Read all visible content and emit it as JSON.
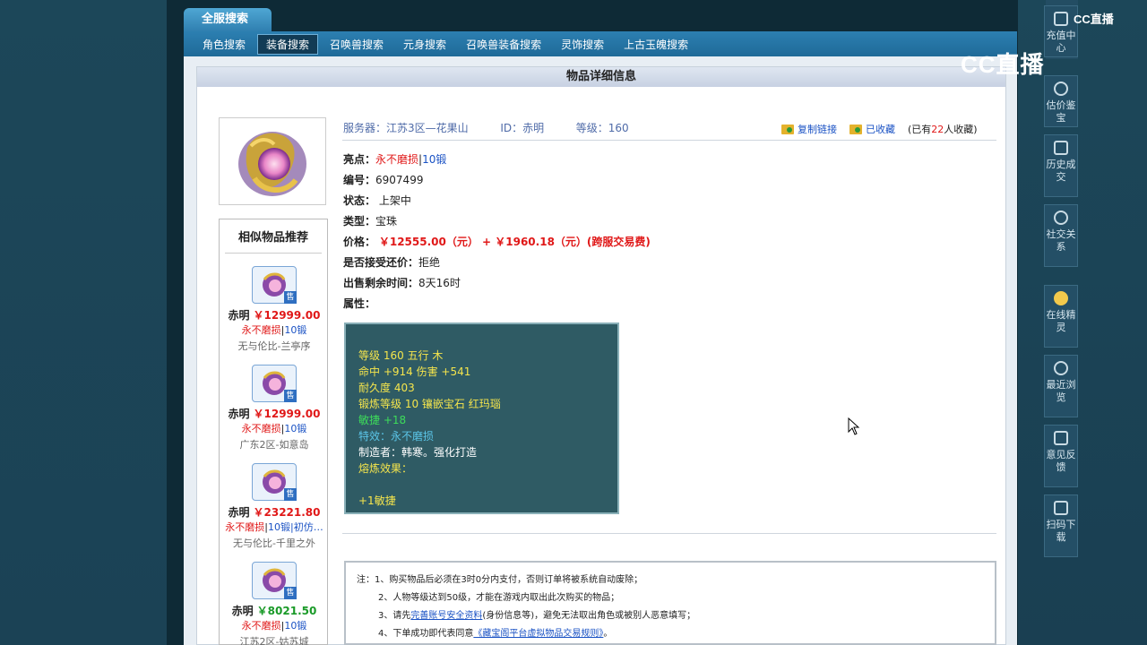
{
  "nav": {
    "top_tab": "全服搜索",
    "sub_tabs": [
      "角色搜索",
      "装备搜索",
      "召唤兽搜索",
      "元身搜索",
      "召唤兽装备搜索",
      "灵饰搜索",
      "上古玉魄搜索"
    ],
    "active_sub_tab": "装备搜索"
  },
  "detail": {
    "header": "物品详细信息",
    "server_label": "服务器：",
    "server_value": "江苏3区—花果山",
    "id_label": "ID：",
    "id_value": "赤明",
    "level_label": "等级：",
    "level_value": "160",
    "copy_link": "复制链接",
    "collected": "已收藏",
    "collect_prefix": "(已有",
    "collect_count": "22",
    "collect_suffix": "人收藏)",
    "highlight_label": "亮点：",
    "highlight_red": "永不磨损",
    "highlight_sep": "|",
    "highlight_blue": "10锻",
    "serial_label": "编号：",
    "serial_value": "6907499",
    "status_label": "状态：",
    "status_value": "上架中",
    "type_label": "类型：",
    "type_value": "宝珠",
    "price_label": "价格：",
    "price_value": "￥12555.00（元） + ￥1960.18（元）(跨服交易费)",
    "bargain_label": "是否接受还价：",
    "bargain_value": "拒绝",
    "remaining_label": "出售剩余时间：",
    "remaining_value": "8天16时",
    "attr_label": "属性："
  },
  "attributes": {
    "line1": "等级 160  五行 木",
    "line2": "命中 +914 伤害 +541",
    "line3": "耐久度 403",
    "line4": "锻炼等级 10  镶嵌宝石 红玛瑙",
    "line5": "敏捷 +18",
    "line6": "特效：永不磨损",
    "line7": "制造者：韩寒。强化打造",
    "line8": "熔炼效果：",
    "line9": "+1敏捷"
  },
  "similar": {
    "title": "相似物品推荐",
    "sell_badge": "售",
    "items": [
      {
        "name": "赤明",
        "price": "￥12999.00",
        "tag_red": "永不磨损",
        "sep": "|",
        "tag_blue": "10锻",
        "extra": "",
        "server": "无与伦比-兰亭序"
      },
      {
        "name": "赤明",
        "price": "￥12999.00",
        "tag_red": "永不磨损",
        "sep": "|",
        "tag_blue": "10锻",
        "extra": "",
        "server": "广东2区-如意岛"
      },
      {
        "name": "赤明",
        "price": "￥23221.80",
        "tag_red": "永不磨损",
        "sep": "|",
        "tag_blue": "10锻",
        "extra": "|初仿…",
        "server": "无与伦比-千里之外"
      },
      {
        "name": "赤明",
        "price": "￥8021.50",
        "tag_red": "永不磨损",
        "sep": "|",
        "tag_blue": "10锻",
        "extra": "",
        "server": "江苏2区-姑苏城"
      }
    ]
  },
  "notes": {
    "prefix": "注：",
    "n1": "1、购买物品后必须在3时0分内支付，否则订单将被系统自动废除；",
    "n2": "2、人物等级达到50级，才能在游戏内取出此次购买的物品；",
    "n3_a": "3、请先",
    "n3_link": "完善账号安全资料",
    "n3_b": "(身份信息等)，避免无法取出角色或被别人恶意填写；",
    "n4_a": "4、下单成功即代表同意",
    "n4_link": "《藏宝阁平台虚拟物品交易规则》",
    "n4_b": "。"
  },
  "sidebar": {
    "items": [
      "充值中心",
      "估价鉴宝",
      "历史成交",
      "社交关系",
      "在线精灵",
      "最近浏览",
      "意见反馈",
      "扫码下载"
    ]
  },
  "watermark": {
    "big": "CC直播",
    "small": "CC直播"
  }
}
